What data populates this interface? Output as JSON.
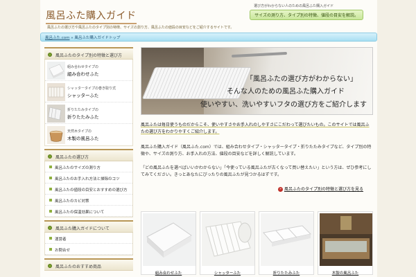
{
  "header": {
    "logo": "風呂ふた購入ガイド",
    "description": "風呂ふたの選び方や風呂ふたのタイプ別の特徴、サイズの測り方、風呂ふたの値段の目安などをご紹介するサイトです。",
    "tag_small": "選び方がわからない人のための風呂ふた購入ガイド",
    "tag_banner": "サイズの測り方、タイプ別の特徴、値段の目安を解説。"
  },
  "breadcrumb": {
    "home": "風呂ふた.com",
    "sep": " » ",
    "current": "風呂ふた購入ガイドトップ"
  },
  "sidebar": {
    "products_heading": "風呂ふたのタイプ別の特徴と選び方",
    "products": [
      {
        "small": "組み合わせタイプの",
        "big": "組み合わせふた"
      },
      {
        "small": "シャッタータイプの巻き取り式",
        "big": "シャッターふた"
      },
      {
        "small": "折りたたみタイプの",
        "big": "折りたたみふた"
      },
      {
        "small": "天然木タイプの",
        "big": "木製の風呂ふた"
      }
    ],
    "menu1_heading": "風呂ふたの選び方",
    "menu1": [
      "風呂ふたのサイズの測り方",
      "風呂ふたのお手入れ方法と掃除のコツ",
      "風呂ふたの値段の目安とおすすめの選び方",
      "風呂ふたのカビ対策",
      "風呂ふたの保温効果について"
    ],
    "menu2_heading": "風呂ふた購入ガイドについて",
    "menu2": [
      "運営者",
      "お問合せ"
    ],
    "menu3_heading": "風呂ふたのおすすめ商品"
  },
  "hero": {
    "line1": "「風呂ふたの選び方がわからない」",
    "line2": "そんな人のための風呂ふた購入ガイド",
    "line3": "使いやすい、洗いやすいフタの選び方をご紹介します"
  },
  "main": {
    "p1": "風呂ふたは毎日使うものだからこそ、使いやすさやお手入れのしやすさにこだわって選びたいもの。このサイトでは風呂ふたの選び方をわかりやすくご紹介します。",
    "p2": "風呂ふた購入ガイド（風呂ふた.com）では、組み合わせタイプ・シャッタータイプ・折りたたみタイプなど、タイプ別の特徴や、サイズの測り方、お手入れの方法、値段の目安などを詳しく解説しています。",
    "p3": "「どの風呂ふたを選べばいいかわからない」「今使っている風呂ふたが古くなって買い替えたい」という方は、ぜひ参考にしてみてください。きっとあなたにぴったりの風呂ふたが見つかるはずです。",
    "more_icon": "»",
    "more_link": "風呂ふたのタイプ別の特徴と選び方を見る"
  },
  "cards": [
    {
      "caption": "組み合わせふた"
    },
    {
      "caption": "シャッターふた"
    },
    {
      "caption": "折りたたみふた"
    },
    {
      "caption": "木製の風呂ふた"
    }
  ],
  "colors": {
    "accent_brown": "#8a5a2a",
    "breadcrumb_blue": "#a9dff2",
    "green_dot": "#7ba02e",
    "banner_green": "#c8e69a"
  }
}
